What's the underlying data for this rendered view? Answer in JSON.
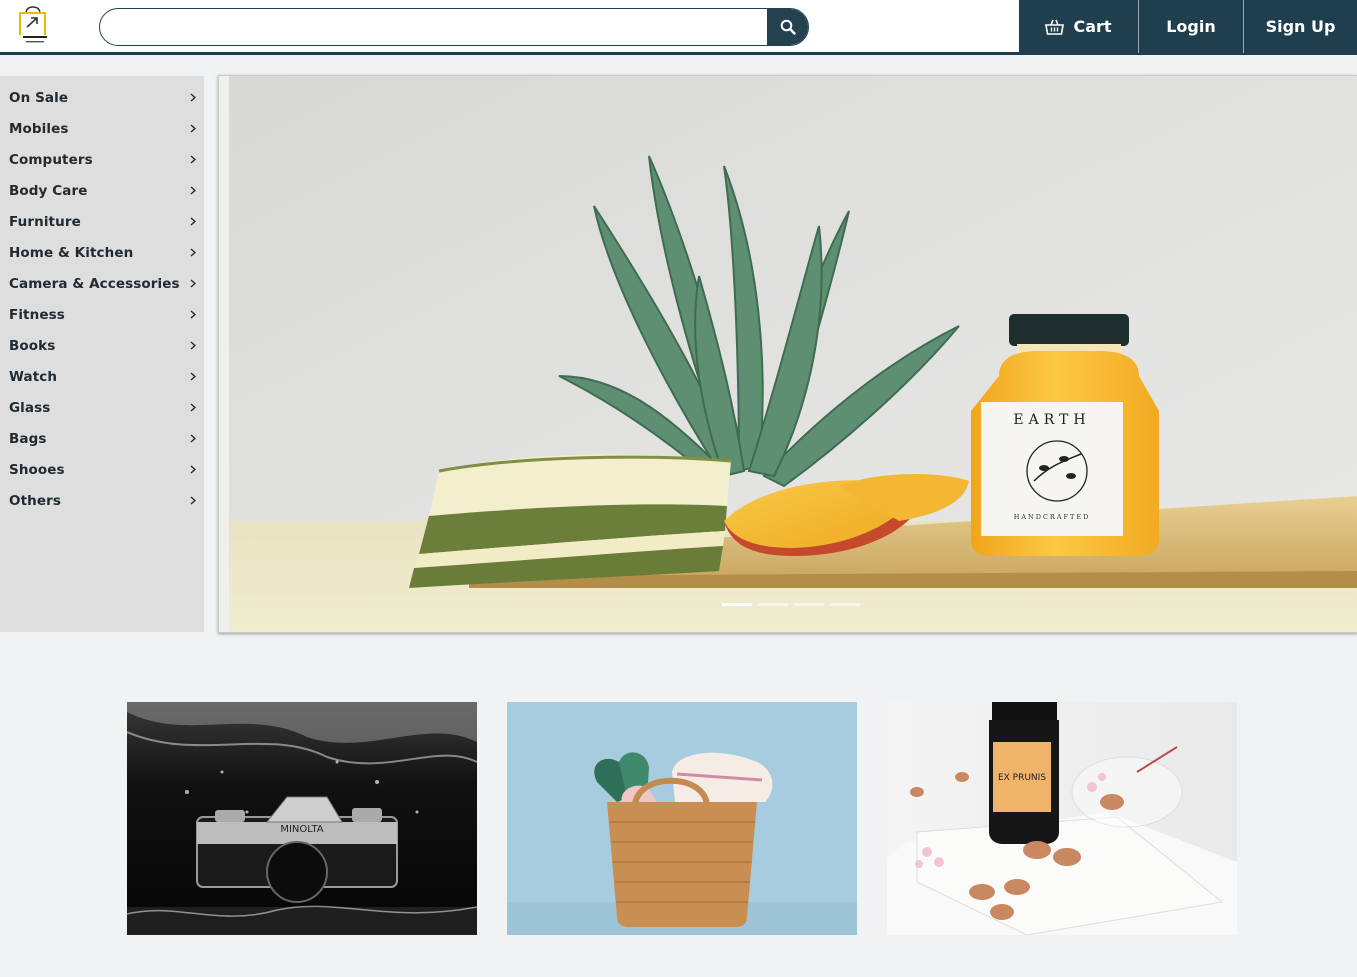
{
  "header": {
    "search": {
      "value": "",
      "placeholder": ""
    },
    "nav": {
      "cart_label": "Cart",
      "login_label": "Login",
      "signup_label": "Sign Up"
    },
    "colors": {
      "primary": "#1f3f4f",
      "logo_accent": "#f2b705"
    }
  },
  "sidebar": {
    "items": [
      {
        "label": "On Sale"
      },
      {
        "label": "Mobiles"
      },
      {
        "label": "Computers"
      },
      {
        "label": "Body Care"
      },
      {
        "label": "Furniture"
      },
      {
        "label": "Home & Kitchen"
      },
      {
        "label": "Camera & Accessories"
      },
      {
        "label": "Fitness"
      },
      {
        "label": "Books"
      },
      {
        "label": "Watch"
      },
      {
        "label": "Glass"
      },
      {
        "label": "Bags"
      },
      {
        "label": "Shooes"
      },
      {
        "label": "Others"
      }
    ]
  },
  "hero": {
    "jar_label_brand": "EARTH",
    "jar_label_sub": "HANDCRAFTED",
    "slide_count": 4,
    "active_slide": 1
  },
  "tiles": [
    {
      "camera_brand": "MINOLTA"
    },
    {},
    {
      "bottle_label": "EX PRUNIS"
    }
  ]
}
